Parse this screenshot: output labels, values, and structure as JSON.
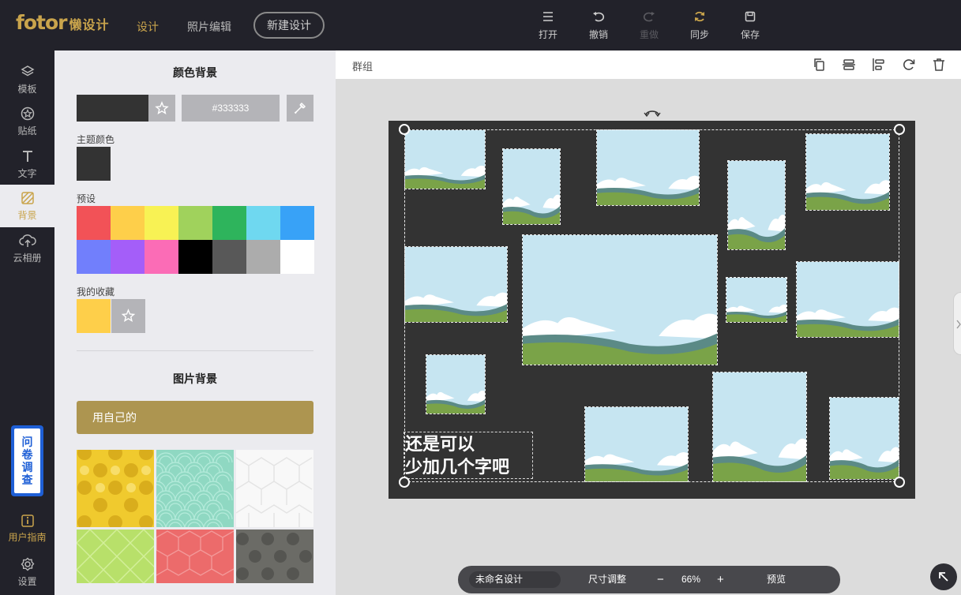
{
  "logo": {
    "brand": "fotor",
    "sub": "懒设计"
  },
  "topnav": {
    "design": "设计",
    "photo_edit": "照片编辑",
    "new_design": "新建设计"
  },
  "toolbar": {
    "open": "打开",
    "undo": "撤销",
    "redo": "重做",
    "sync": "同步",
    "save": "保存"
  },
  "rail": {
    "template": "模板",
    "sticker": "贴纸",
    "text": "文字",
    "background": "背景",
    "cloud": "云相册",
    "guide": "用户指南",
    "settings": "设置"
  },
  "survey": {
    "label": "问卷调查"
  },
  "panel": {
    "color_bg_title": "颜色背景",
    "current_color": "#333333",
    "theme_label": "主题颜色",
    "theme_color": "#333333",
    "preset_label": "预设",
    "presets": [
      "#f25257",
      "#fecf4a",
      "#f8f254",
      "#a0d25c",
      "#2eb45c",
      "#6fd8f0",
      "#38a2f7",
      "#717ffc",
      "#a45ef9",
      "#fb6cb6",
      "#000000",
      "#585858",
      "#acacac",
      "#ffffff"
    ],
    "favorites_label": "我的收藏",
    "favorite_color": "#fecf4a",
    "image_bg_title": "图片背景",
    "use_own": "用自己的",
    "patterns": [
      "yellow-dots",
      "mint-scales",
      "white-cubes",
      "green-diamonds",
      "red-hexagons",
      "gray-dots"
    ]
  },
  "canvas": {
    "group_label": "群组",
    "background": "#333333",
    "text_line1": "还是可以",
    "text_line2": "少加几个字吧"
  },
  "bottombar": {
    "design_name": "未命名设计",
    "resize": "尺寸调整",
    "zoom_minus": "−",
    "zoom": "66%",
    "zoom_plus": "+",
    "preview": "预览"
  },
  "colors": {
    "accent": "#c9a44c",
    "topbar": "#22222a",
    "survey": "#1e5fd6"
  }
}
